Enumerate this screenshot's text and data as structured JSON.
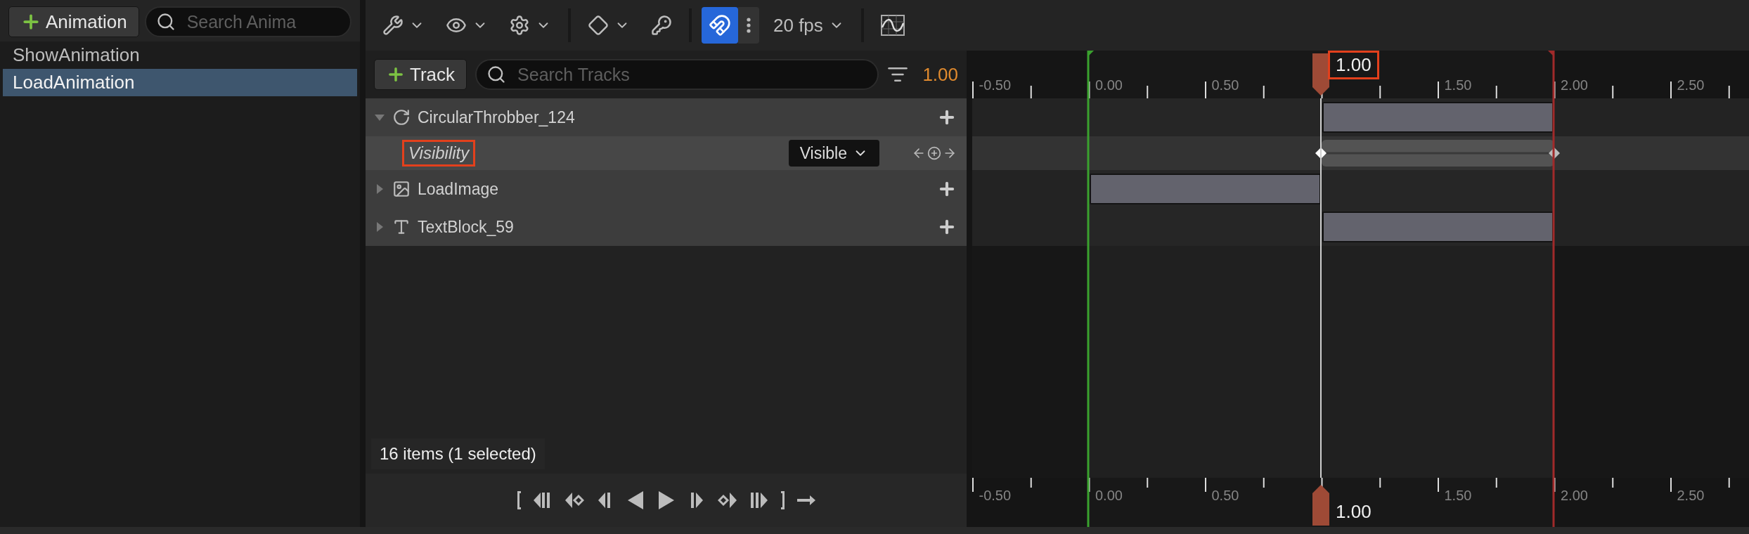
{
  "asset_panel": {
    "add_button": "Animation",
    "search": {
      "placeholder": "Search Anima"
    },
    "animations": [
      {
        "name": "ShowAnimation",
        "selected": false
      },
      {
        "name": "LoadAnimation",
        "selected": true
      }
    ]
  },
  "toolbar": {
    "fps": "20 fps",
    "snap_on": true
  },
  "tracks_header": {
    "add_button": "Track",
    "search": {
      "placeholder": "Search Tracks"
    },
    "current_time": "1.00"
  },
  "tracks": [
    {
      "name": "CircularThrobber_124",
      "kind": "throbber",
      "expanded": true,
      "first_half": false,
      "second_half": true,
      "children": [
        {
          "name": "Visibility",
          "kind": "visibility",
          "value": "Visible",
          "highlighted": true
        }
      ]
    },
    {
      "name": "LoadImage",
      "kind": "image",
      "expanded": false,
      "first_half": true,
      "second_half": false
    },
    {
      "name": "TextBlock_59",
      "kind": "text",
      "expanded": false,
      "first_half": false,
      "second_half": true
    }
  ],
  "status": "16 items (1 selected)",
  "timeline": {
    "ruler_labels": [
      "-0.50",
      "0.00",
      "0.50",
      "1.50",
      "2.00",
      "2.50"
    ],
    "playhead": {
      "label": "1.00",
      "highlighted": true
    },
    "bottom_ruler_labels": [
      "-0.50",
      "0.00",
      "0.50",
      "1.50",
      "2.00",
      "2.50"
    ],
    "bottom_playhead_label": "1.00"
  }
}
